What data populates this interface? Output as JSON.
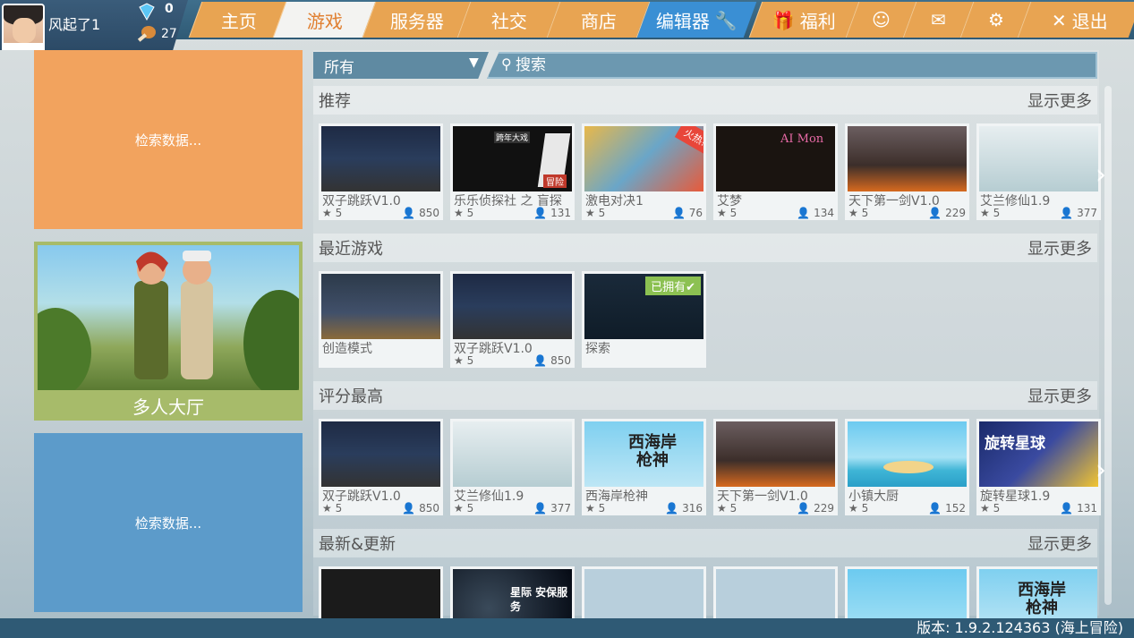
{
  "user": {
    "name": "风起了1",
    "gems": "0",
    "food": "27"
  },
  "tabs": {
    "home": "主页",
    "games": "游戏",
    "servers": "服务器",
    "social": "社交",
    "shop": "商店",
    "editor": "编辑器"
  },
  "utils": {
    "welfare": "福利",
    "logout": "退出"
  },
  "left_panels": {
    "panel_a": "检索数据...",
    "lobby": "多人大厅",
    "panel_c": "检索数据..."
  },
  "filter": {
    "selected": "所有",
    "search_placeholder": "搜索"
  },
  "more_label": "显示更多",
  "sections": [
    {
      "title": "推荐",
      "cards": [
        {
          "name": "双子跳跃V1.0",
          "rating": "5",
          "players": "850"
        },
        {
          "name": "乐乐侦探社 之 盲探",
          "rating": "5",
          "players": "131"
        },
        {
          "name": "激电对决1",
          "rating": "5",
          "players": "76"
        },
        {
          "name": "艾梦",
          "rating": "5",
          "players": "134"
        },
        {
          "name": "天下第一剑V1.0",
          "rating": "5",
          "players": "229"
        },
        {
          "name": "艾兰修仙1.9",
          "rating": "5",
          "players": "377"
        }
      ]
    },
    {
      "title": "最近游戏",
      "cards": [
        {
          "name": "创造模式",
          "rating": "",
          "players": ""
        },
        {
          "name": "双子跳跃V1.0",
          "rating": "5",
          "players": "850"
        },
        {
          "name": "探索",
          "rating": "",
          "players": "",
          "badge": "已拥有✔"
        }
      ]
    },
    {
      "title": "评分最高",
      "cards": [
        {
          "name": "双子跳跃V1.0",
          "rating": "5",
          "players": "850"
        },
        {
          "name": "艾兰修仙1.9",
          "rating": "5",
          "players": "377"
        },
        {
          "name": "西海岸枪神",
          "rating": "5",
          "players": "316"
        },
        {
          "name": "天下第一剑V1.0",
          "rating": "5",
          "players": "229"
        },
        {
          "name": "小镇大厨",
          "rating": "5",
          "players": "152"
        },
        {
          "name": "旋转星球1.9",
          "rating": "5",
          "players": "131"
        }
      ]
    },
    {
      "title": "最新&更新"
    }
  ],
  "thumb_text": {
    "hot": "火热!",
    "ai": "AI Mon",
    "xhacs": "西海岸 枪神",
    "xzxq": "旋转星球",
    "xjab": "星际 安保服务",
    "maoxian": "冒险",
    "kuanian": "跨年大戏"
  },
  "version": "版本:  1.9.2.124363 (海上冒险)",
  "colors": {
    "accent": "#e8a452",
    "editor": "#3a8fd4",
    "lobby": "#a7bb6a"
  }
}
